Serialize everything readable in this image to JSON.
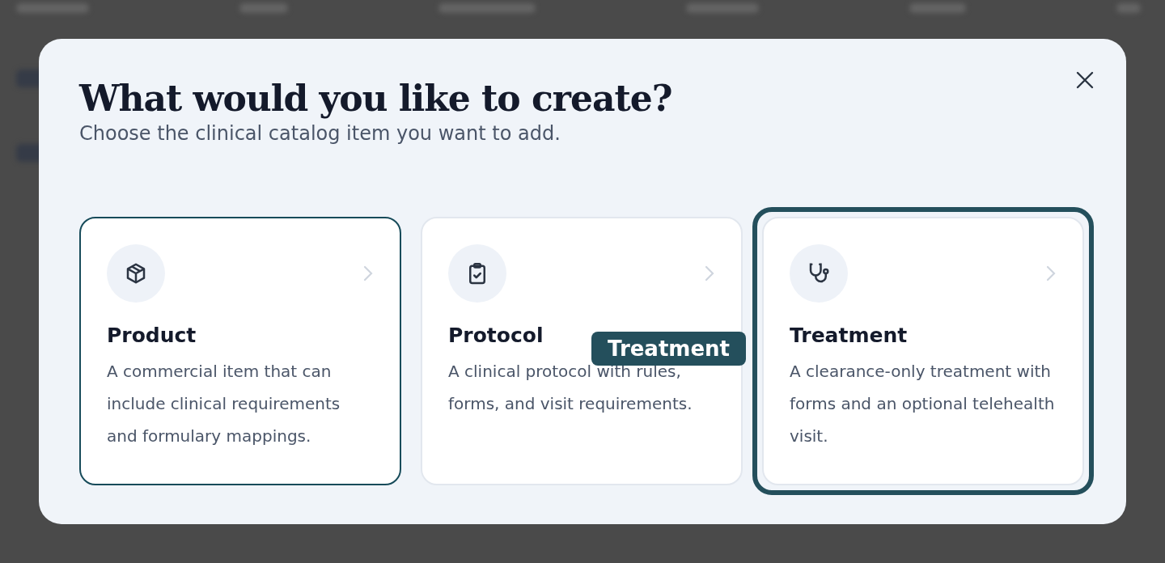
{
  "dialog": {
    "title": "What would you like to create?",
    "subtitle": "Choose the clinical catalog item you want to add.",
    "options": [
      {
        "kind": "box",
        "title": "Product",
        "description": "A commercial item that can include clinical requirements and formulary mappings.",
        "hovered": true,
        "focused": false
      },
      {
        "kind": "clipboard",
        "title": "Protocol",
        "description": "A clinical protocol with rules, forms, and visit requirements.",
        "hovered": false,
        "focused": false
      },
      {
        "kind": "stethoscope",
        "title": "Treatment",
        "description": "A clearance-only treatment with forms and an optional telehealth visit.",
        "hovered": false,
        "focused": true
      }
    ],
    "tooltip": {
      "text": "Treatment"
    }
  }
}
